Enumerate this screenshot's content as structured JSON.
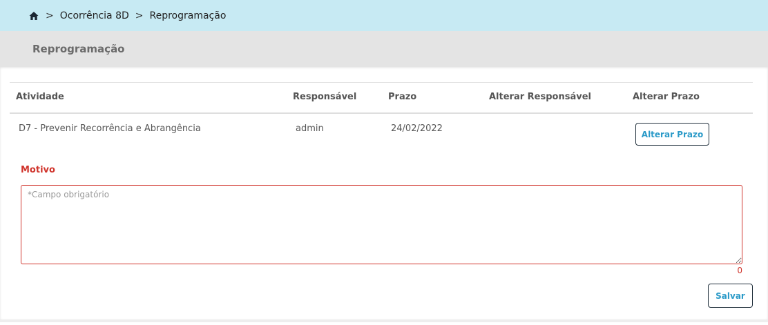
{
  "breadcrumb": {
    "separator": ">",
    "items": [
      "Ocorrência 8D",
      "Reprogramação"
    ]
  },
  "page": {
    "title": "Reprogramação"
  },
  "table": {
    "headers": {
      "atividade": "Atividade",
      "responsavel": "Responsável",
      "prazo": "Prazo",
      "alterar_responsavel": "Alterar Responsável",
      "alterar_prazo": "Alterar Prazo"
    },
    "rows": [
      {
        "atividade": "D7 - Prevenir Recorrência e Abrangência",
        "responsavel": "admin",
        "prazo": "24/02/2022",
        "alterar_prazo_button": "Alterar Prazo"
      }
    ]
  },
  "motivo": {
    "label": "Motivo",
    "placeholder": "*Campo obrigatório",
    "value": "",
    "char_count": "0"
  },
  "actions": {
    "save_label": "Salvar"
  },
  "colors": {
    "breadcrumb_bg": "#c7eaf3",
    "header_bg": "#e4e4e4",
    "required_red": "#d0342c",
    "button_text": "#2b9ac8"
  },
  "icons": {
    "home": "home-icon"
  }
}
